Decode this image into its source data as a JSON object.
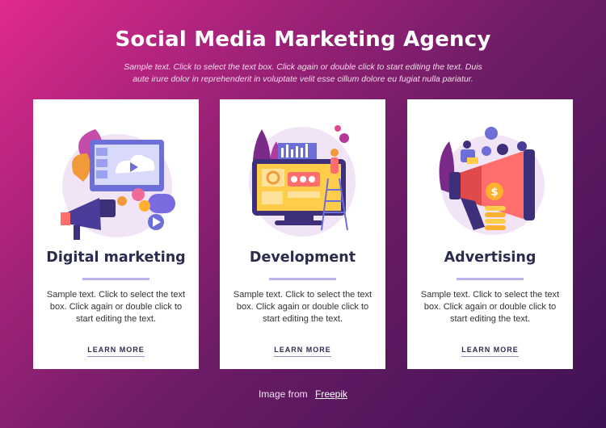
{
  "hero": {
    "title": "Social Media Marketing Agency",
    "subtitle": "Sample text. Click to select the text box. Click again or double click to start editing the text. Duis aute irure dolor in reprehenderit in voluptate velit esse cillum dolore eu fugiat nulla pariatur."
  },
  "cards": [
    {
      "title": "Digital marketing",
      "description": "Sample text. Click to select the text box. Click again or double click to start editing the text.",
      "link": "LEARN MORE",
      "illustration": "digital-marketing-illustration"
    },
    {
      "title": "Development",
      "description": "Sample text. Click to select the text box. Click again or double click to start editing the text.",
      "link": "LEARN MORE",
      "illustration": "development-illustration"
    },
    {
      "title": "Advertising",
      "description": "Sample text. Click to select the text box. Click again or double click to start editing the text.",
      "link": "LEARN MORE",
      "illustration": "advertising-illustration"
    }
  ],
  "footer": {
    "prefix": "Image from",
    "link": "Freepik"
  },
  "colors": {
    "background_start": "#e02a8c",
    "background_end": "#3e1254",
    "card": "#ffffff",
    "heading": "#2b2b4d",
    "accent_bar": "#b7b3e8"
  }
}
